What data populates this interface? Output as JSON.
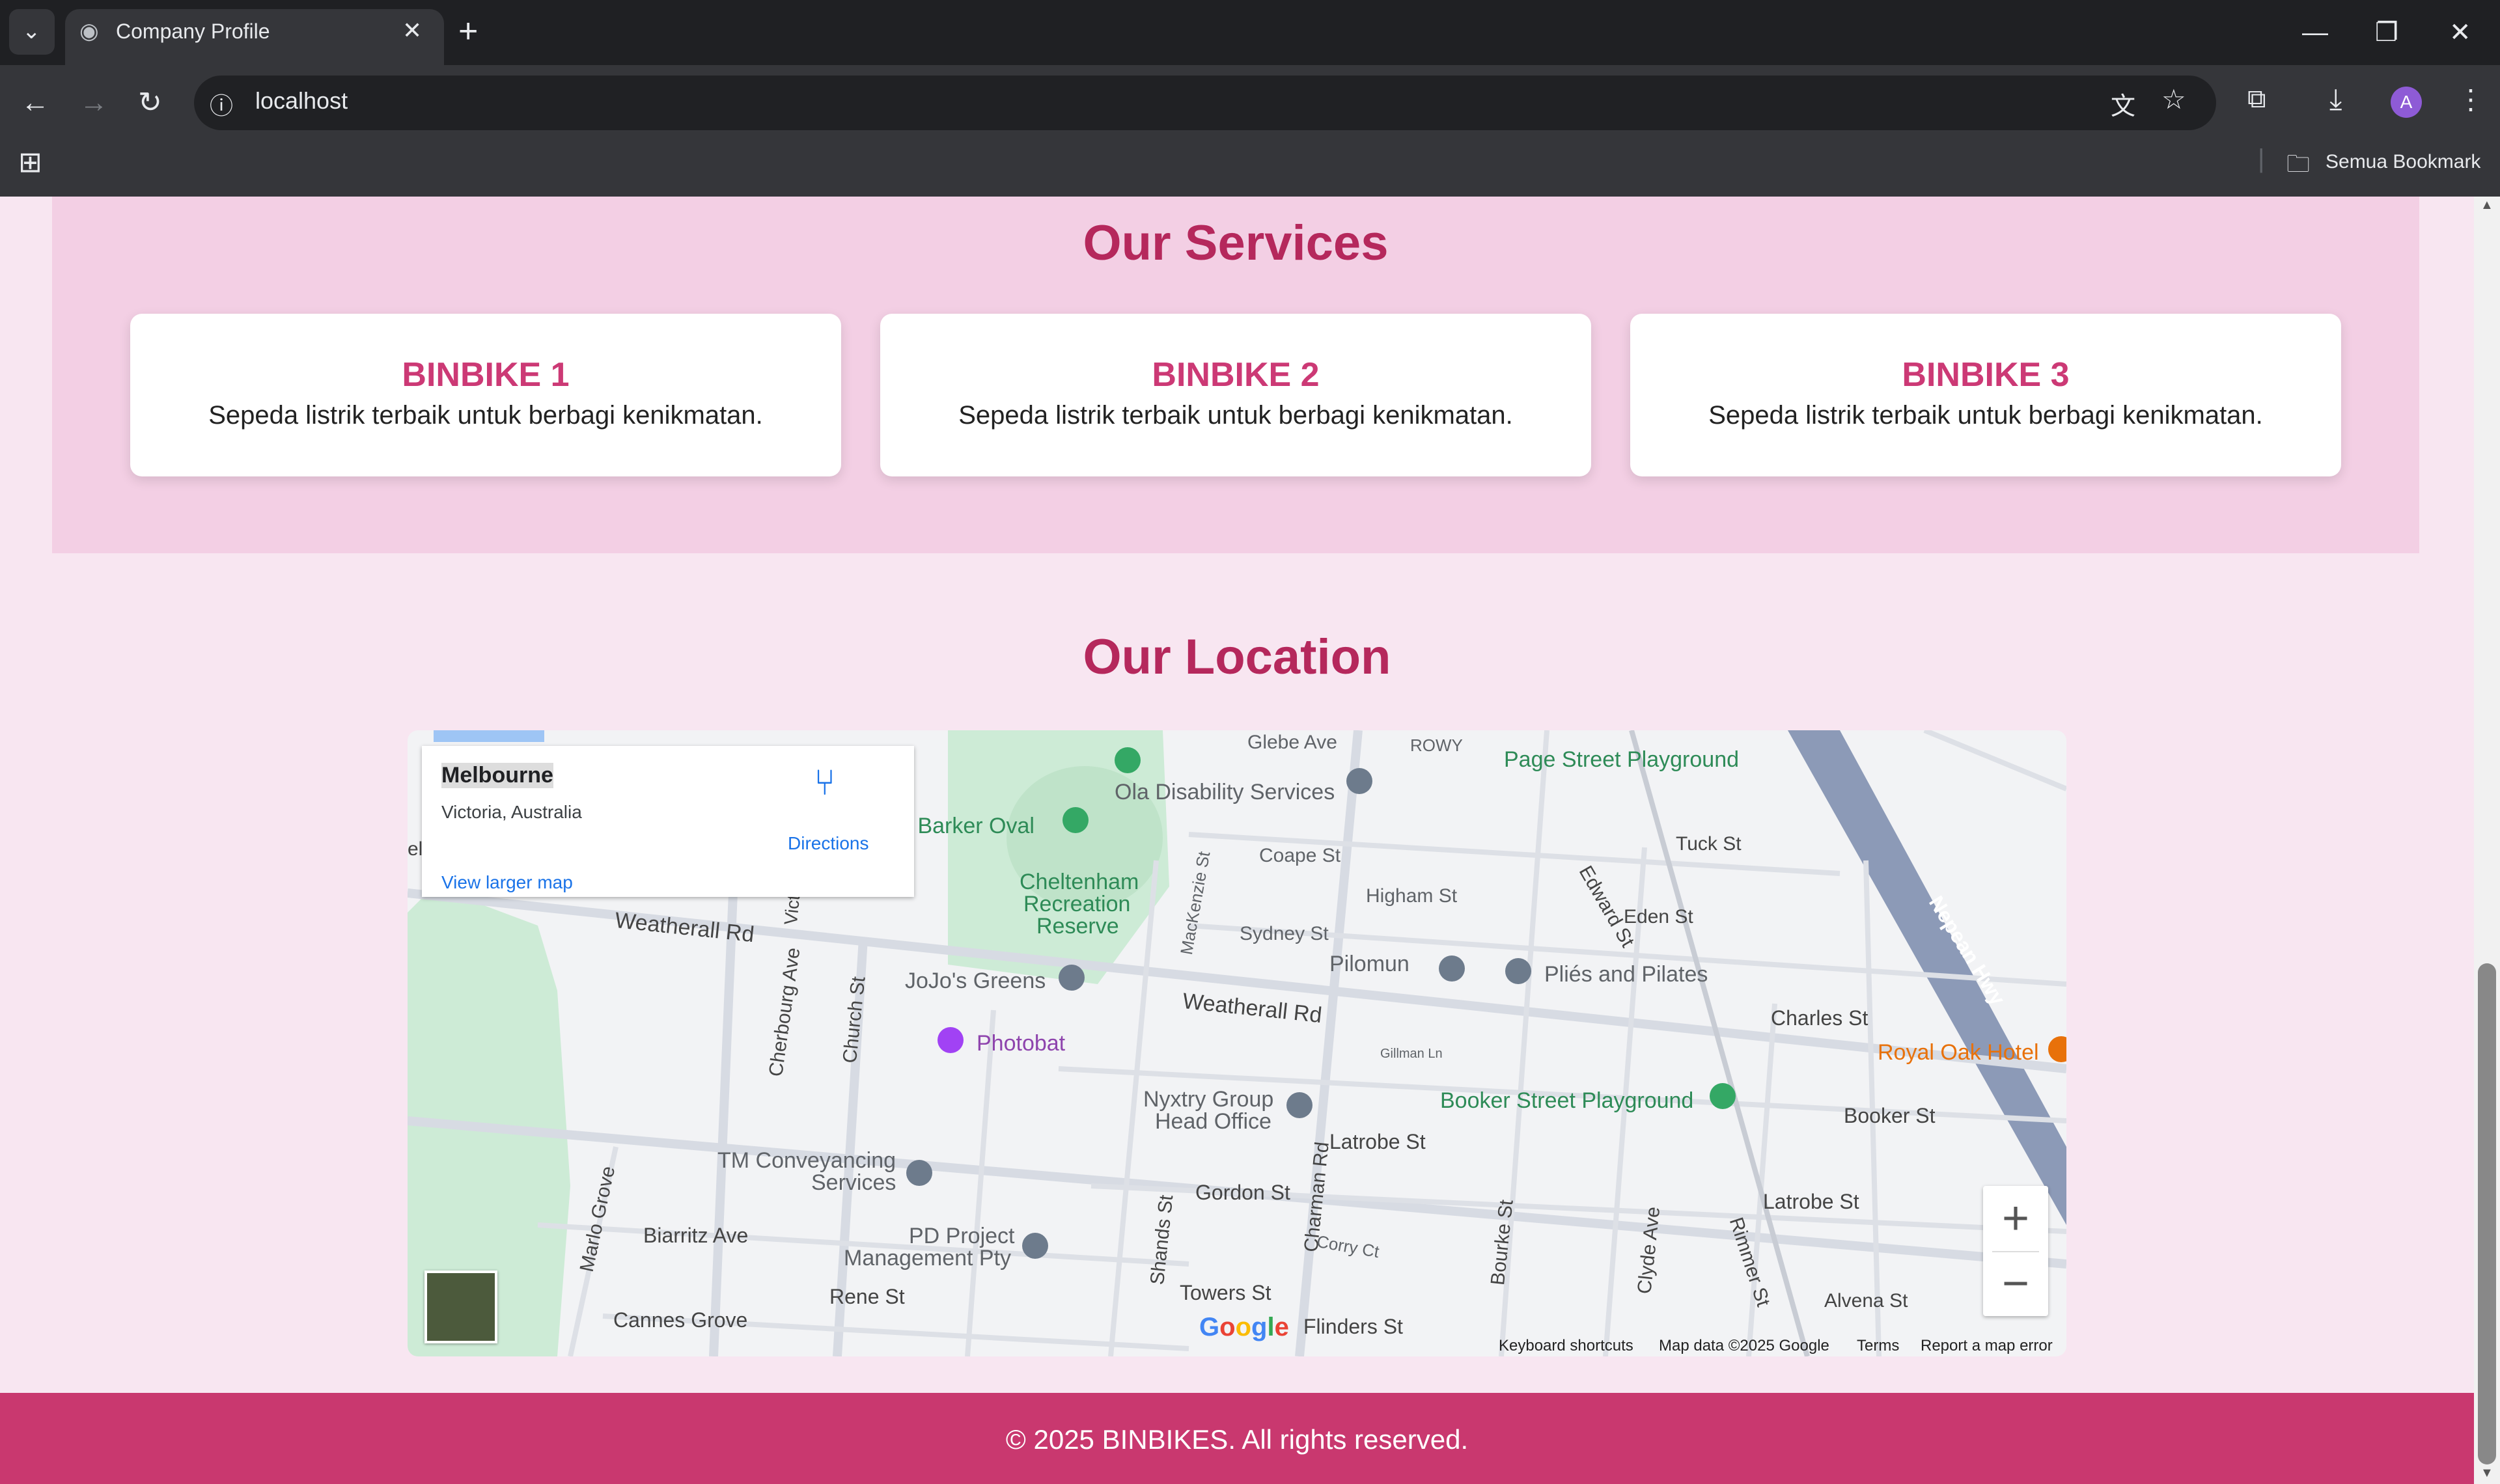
{
  "browser": {
    "tab_title": "Company Profile",
    "url": "localhost",
    "bookmarks_label": "Semua Bookmark",
    "profile_initial": "A"
  },
  "services": {
    "title": "Our Services",
    "cards": [
      {
        "title": "BINBIKE 1",
        "description": "Sepeda listrik terbaik untuk berbagi kenikmatan."
      },
      {
        "title": "BINBIKE 2",
        "description": "Sepeda listrik terbaik untuk berbagi kenikmatan."
      },
      {
        "title": "BINBIKE 3",
        "description": "Sepeda listrik terbaik untuk berbagi kenikmatan."
      }
    ]
  },
  "location": {
    "title": "Our Location",
    "infocard": {
      "place": "Melbourne",
      "region": "Victoria, Australia",
      "directions": "Directions",
      "larger_map": "View larger map"
    },
    "attribution": {
      "shortcuts": "Keyboard shortcuts",
      "map_data": "Map data ©2025 Google",
      "terms": "Terms",
      "report": "Report a map error"
    },
    "streets": [
      "Glebe Ave",
      "ROWY",
      "Page Street Playground",
      "Ola Disability Services",
      "ck Barker Oval",
      "Coape St",
      "Tuck St",
      "Cheltenham",
      "Recreation",
      "Reserve",
      "Higham St",
      "Eden St",
      "Edward St",
      "Nepean Hwy",
      "Weatherall Rd",
      "Sydney St",
      "MacKenzie St",
      "Pilomun",
      "Pliés and Pilates",
      "JoJo's Greens",
      "Weatherall Rd",
      "Charles St",
      "Cherbourg Ave",
      "Church St",
      "Photobat",
      "Gillman Ln",
      "Royal Oak Hotel",
      "Nyxtry Group",
      "Head Office",
      "Booker Street Playground",
      "Booker St",
      "Latrobe St",
      "TM Conveyancing",
      "Services",
      "Marlo Grove",
      "Gordon St",
      "Latrobe St",
      "Charman Rd",
      "Biarritz Ave",
      "PD Project",
      "Management Pty",
      "Shands St",
      "Corry Ct",
      "Bourke St",
      "Clyde Ave",
      "Rimmer St",
      "Alvena St",
      "Rene St",
      "Towers St",
      "Cannes Grove",
      "Flinders St",
      "Vict",
      "el"
    ]
  },
  "footer": {
    "text": "© 2025 BINBIKES. All rights reserved."
  },
  "colors": {
    "accent": "#b5285c",
    "footer": "#c9386f",
    "services_bg": "#f3cfe4"
  }
}
